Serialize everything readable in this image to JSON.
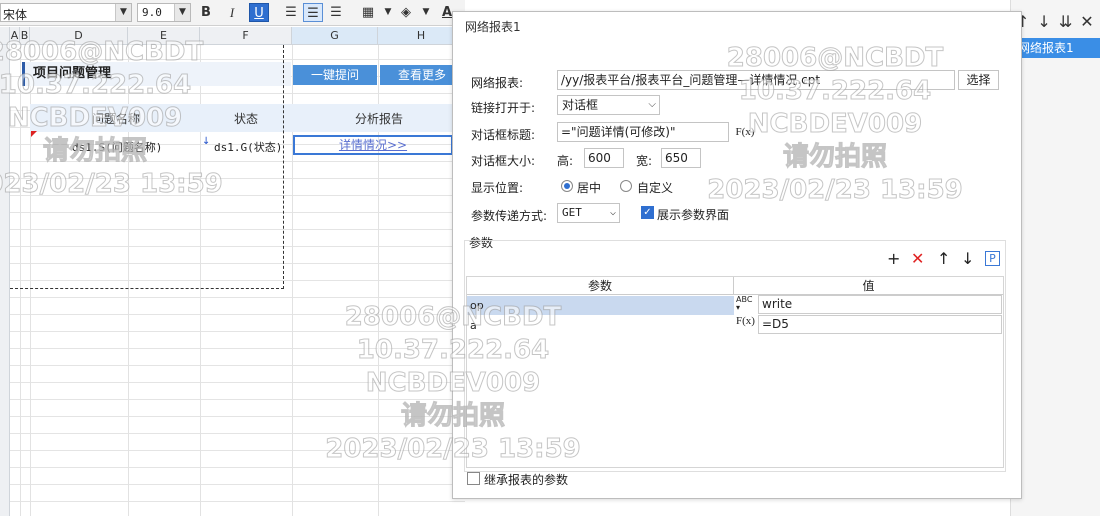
{
  "toolbar": {
    "font_name": "宋体",
    "font_size": "9.0",
    "bold": "B",
    "italic": "I",
    "underline": "U",
    "align_icons": [
      "align-left-icon",
      "align-center-icon",
      "align-right-icon"
    ],
    "border_icon": "border-icon",
    "fill_icon": "fill-color-icon",
    "text_color": "A"
  },
  "sheet": {
    "columns": [
      "A",
      "B",
      "D",
      "E",
      "F",
      "G",
      "H"
    ],
    "title": "项目问题管理",
    "headers": {
      "name": "问题名称",
      "status": "状态",
      "report": "分析报告"
    },
    "buttons": {
      "submit": "一键提问",
      "more": "查看更多"
    },
    "formula_name": "ds1.S(问题名称)",
    "formula_status": "ds1.G(状态)",
    "link": "详情情况>>"
  },
  "right_panel": {
    "item": "网络报表1",
    "icons": [
      "move-up-icon",
      "move-down-icon",
      "move-bottom-icon",
      "tools-icon"
    ]
  },
  "dialog": {
    "title": "网络报表1",
    "report_label": "网络报表:",
    "report_path": "/yy/报表平台/报表平台_问题管理—详情情况.cpt",
    "select_button": "选择",
    "open_in_label": "链接打开于:",
    "open_in_value": "对话框",
    "dlg_title_label": "对话框标题:",
    "dlg_title_value": "=\"问题详情(可修改)\"",
    "fx_label": "F(x)",
    "size_label": "对话框大小:",
    "height_label": "高:",
    "height_value": "600",
    "width_label": "宽:",
    "width_value": "650",
    "position_label": "显示位置:",
    "position_center": "居中",
    "position_custom": "自定义",
    "param_method_label": "参数传递方式:",
    "param_method_value": "GET",
    "show_param_ui": "展示参数界面",
    "params_section": "参数",
    "table_headers": {
      "param": "参数",
      "value": "值"
    },
    "rows": [
      {
        "param": "op",
        "type_icon": "abc-type-icon",
        "value": "write"
      },
      {
        "param": "a",
        "type_icon": "fx-type-icon",
        "value": "=D5"
      }
    ],
    "inherit_label": "继承报表的参数"
  },
  "watermark": {
    "lines": [
      "28006@NCBDT",
      "10.37.222.64",
      "NCBDEV009",
      "请勿拍照",
      "2023/02/23 13:59"
    ]
  }
}
